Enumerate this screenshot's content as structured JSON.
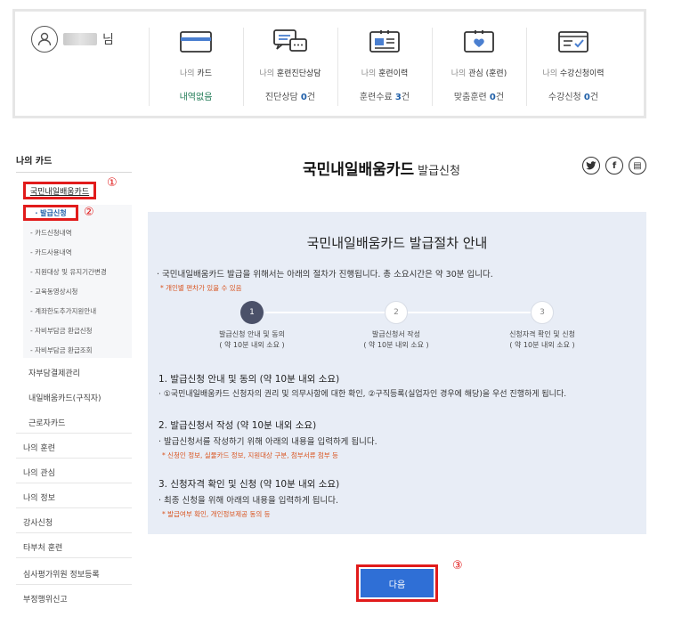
{
  "user": {
    "suffix": "님"
  },
  "stats": [
    {
      "label_pre": "나의 ",
      "label_em": "카드",
      "label_post": "",
      "value": "내역없음",
      "num": "",
      "unit": ""
    },
    {
      "label_pre": "나의 ",
      "label_em": "훈련진단상담",
      "label_post": "",
      "value": "진단상담 ",
      "num": "0",
      "unit": "건"
    },
    {
      "label_pre": "나의 ",
      "label_em": "훈련이력",
      "label_post": "",
      "value": "훈련수료 ",
      "num": "3",
      "unit": "건"
    },
    {
      "label_pre": "나의 ",
      "label_em": "관심",
      "label_post": " (훈련)",
      "value": "맞춤훈련 ",
      "num": "0",
      "unit": "건"
    },
    {
      "label_pre": "나의 ",
      "label_em": "수강신청이력",
      "label_post": "",
      "value": "수강신청 ",
      "num": "0",
      "unit": "건"
    }
  ],
  "icons": [
    "card-icon",
    "chat-icon",
    "history-icon",
    "heart-doc-icon",
    "checklist-icon"
  ],
  "sidebar": {
    "head": "나의 카드",
    "card_title": "국민내일배움카드",
    "active_sub": "· 발급신청",
    "subs": [
      "- 카드신청내역",
      "- 카드사용내역",
      "- 지원대상 및 유지기간변경",
      "- 교육동영상시청",
      "- 계좌한도추가지원안내",
      "- 자비부담금 환급신청",
      "- 자비부담금 환급조회"
    ],
    "groups": [
      "자부담결제관리",
      "내일배움카드(구직자)",
      "근로자카드"
    ],
    "mains": [
      "나의 훈련",
      "나의 관심",
      "나의 정보",
      "강사신청",
      "타부처 훈련",
      "심사평가위원 정보등록",
      "부정행위신고"
    ]
  },
  "markers": {
    "m1": "①",
    "m2": "②",
    "m3": "③"
  },
  "title": {
    "main": "국민내일배움카드",
    "sub": "발급신청"
  },
  "share": {
    "twitter": "t",
    "facebook": "f",
    "print": "▤"
  },
  "panel": {
    "title": "국민내일배움카드 발급절차 안내",
    "intro": "· 국민내일배움카드 발급을 위해서는 아래의 절차가 진행됩니다. 총 소요시간은 약 30분 입니다.",
    "intro_note": "* 개인별 편차가 있을 수 있음",
    "steps": [
      {
        "num": "1",
        "line1": "발급신청 안내 및 동의",
        "line2": "( 약 10분 내외 소요 )"
      },
      {
        "num": "2",
        "line1": "발급신청서 작성",
        "line2": "( 약 10분 내외 소요 )"
      },
      {
        "num": "3",
        "line1": "신청자격 확인 및 신청",
        "line2": "( 약 10분 내외 소요 )"
      }
    ],
    "sections": [
      {
        "head": "1. 발급신청 안내 및 동의 (약 10분 내외 소요)",
        "desc": "· ①국민내일배움카드 신청자의 권리 및 의무사항에 대한 확인, ②구직등록(실업자인 경우에 해당)을 우선 진행하게 됩니다.",
        "note": ""
      },
      {
        "head": "2. 발급신청서 작성 (약 10분 내외 소요)",
        "desc": "· 발급신청서를 작성하기 위해 아래의 내용을 입력하게 됩니다.",
        "note": "* 신청인 정보, 실물카드 정보, 지원대상 구분, 첨부서류 첨부 등"
      },
      {
        "head": "3. 신청자격 확인 및 신청 (약 10분 내외 소요)",
        "desc": "· 최종 신청을 위해 아래의 내용을 입력하게 됩니다.",
        "note": "* 발급여부 확인, 개인정보제공 동의 등"
      }
    ]
  },
  "next_button": "다음",
  "colors": {
    "accent": "#2f6fd6",
    "highlight": "#e11b1b",
    "panel": "#e8edf6",
    "note": "#d9531e"
  }
}
